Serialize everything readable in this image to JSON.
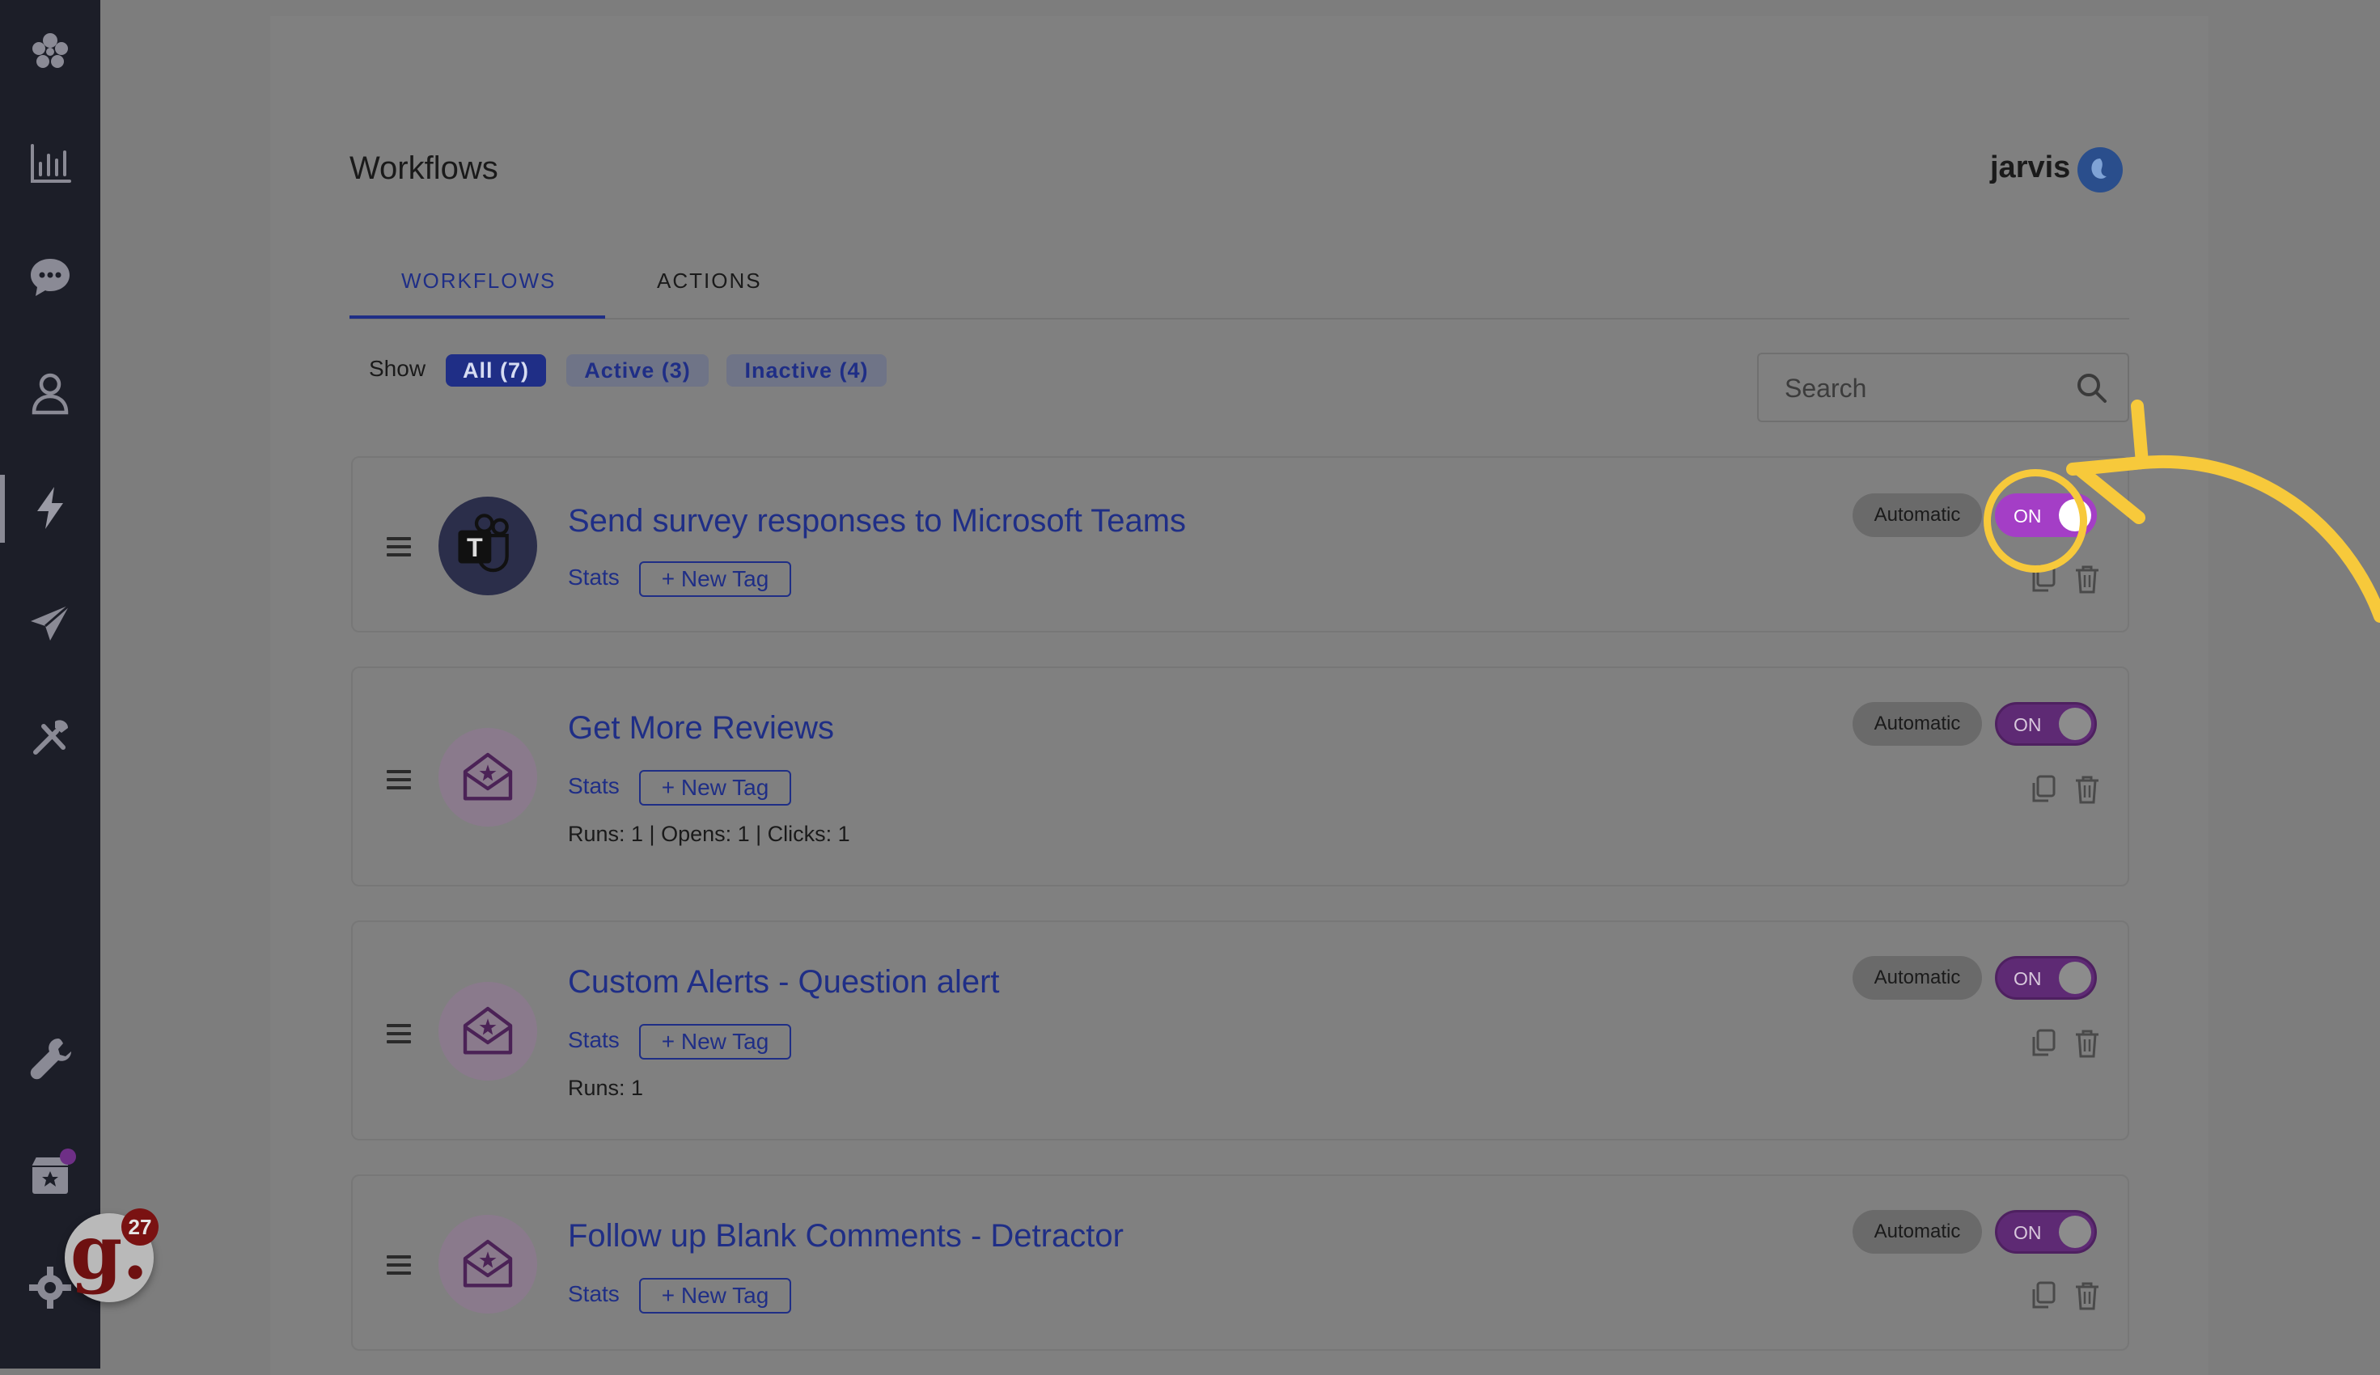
{
  "page": {
    "title": "Workflows",
    "user": {
      "name": "jarvis"
    }
  },
  "tabs": [
    {
      "label": "WORKFLOWS",
      "active": true
    },
    {
      "label": "ACTIONS",
      "active": false
    }
  ],
  "filter": {
    "label": "Show",
    "options": [
      {
        "label": "All (7)",
        "selected": true
      },
      {
        "label": "Active (3)",
        "selected": false
      },
      {
        "label": "Inactive (4)",
        "selected": false
      }
    ]
  },
  "search": {
    "placeholder": "Search",
    "value": ""
  },
  "sidebar": {
    "items": [
      {
        "icon": "flower-logo-icon"
      },
      {
        "icon": "bar-chart-icon"
      },
      {
        "icon": "chat-bubble-icon"
      },
      {
        "icon": "person-icon"
      },
      {
        "icon": "lightning-bolt-icon",
        "active": true
      },
      {
        "icon": "paper-plane-icon"
      },
      {
        "icon": "tools-icon"
      },
      {
        "icon": "wrench-icon"
      },
      {
        "icon": "store-icon"
      },
      {
        "icon": "gear-icon"
      }
    ],
    "assistant": {
      "letter": "g.",
      "badge": "27"
    }
  },
  "workflows": [
    {
      "title": "Send survey responses to Microsoft Teams",
      "stats_label": "Stats",
      "tag_label": "+ New Tag",
      "metrics": "",
      "mode": "Automatic",
      "toggle": "ON",
      "icon": "microsoft-teams-icon"
    },
    {
      "title": "Get More Reviews",
      "stats_label": "Stats",
      "tag_label": "+ New Tag",
      "metrics": "Runs: 1 | Opens: 1 | Clicks: 1",
      "mode": "Automatic",
      "toggle": "ON",
      "icon": "mail-open-icon"
    },
    {
      "title": "Custom Alerts - Question alert",
      "stats_label": "Stats",
      "tag_label": "+ New Tag",
      "metrics": "Runs: 1",
      "mode": "Automatic",
      "toggle": "ON",
      "icon": "mail-open-icon"
    },
    {
      "title": "Follow up Blank Comments - Detractor",
      "stats_label": "Stats",
      "tag_label": "+ New Tag",
      "metrics": "",
      "mode": "Automatic",
      "toggle": "ON",
      "icon": "mail-open-icon"
    }
  ],
  "colors": {
    "accent": "#1f2e86",
    "toggle_highlight": "#a43ec6",
    "annotation": "#f7c93b"
  }
}
